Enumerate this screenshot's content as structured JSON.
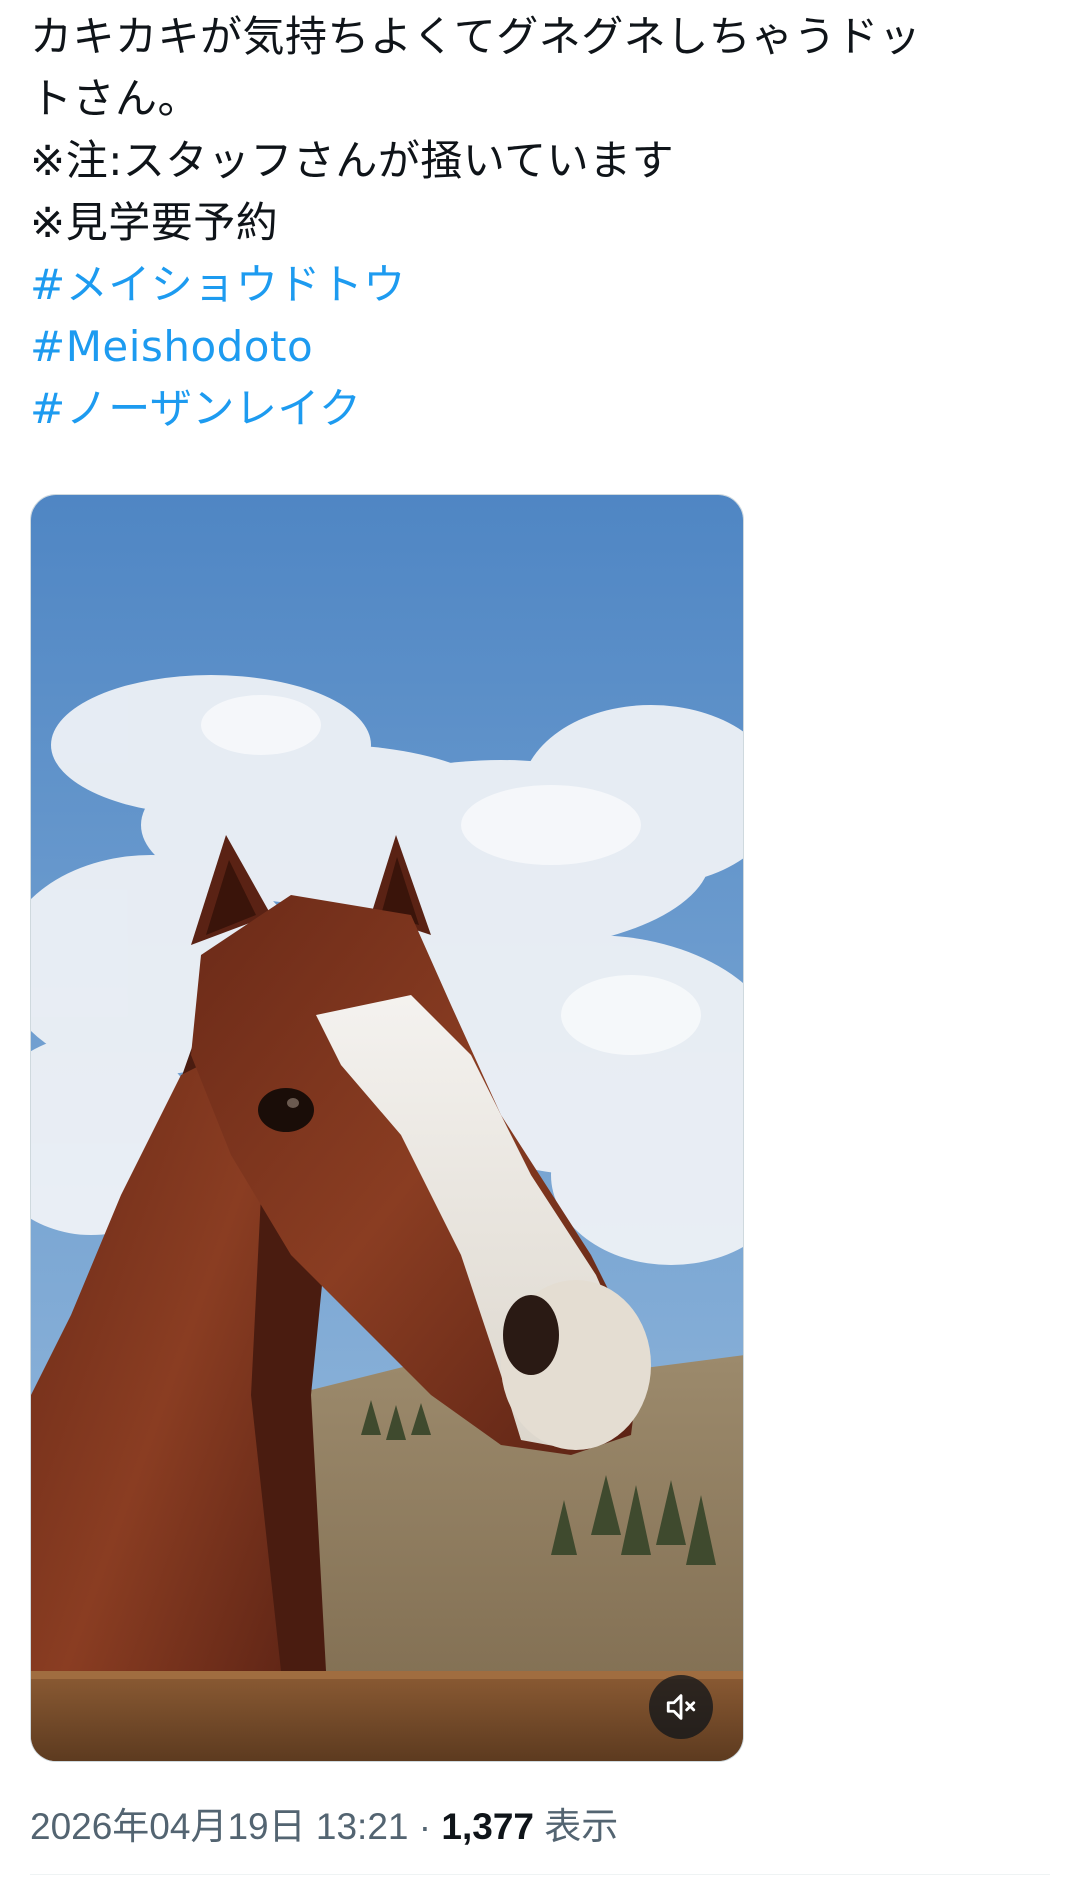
{
  "tweet": {
    "text_lines": [
      "カキカキが気持ちよくてグネグネしちゃうドッ",
      "トさん。",
      "※注:スタッフさんが掻いています",
      "※見学要予約"
    ],
    "hashtags": [
      "#メイショウドトウ",
      "#Meishodoto",
      "#ノーザンレイク"
    ]
  },
  "media": {
    "type": "video",
    "mute_icon": "speaker-muted-icon"
  },
  "meta": {
    "datetime": "2026年04月19日 13:21",
    "separator": "·",
    "views_count": "1,377",
    "views_label": "表示"
  },
  "colors": {
    "text": "#0f1419",
    "hashtag": "#1d9bf0",
    "meta_text": "#536471",
    "divider": "#eff3f4"
  }
}
